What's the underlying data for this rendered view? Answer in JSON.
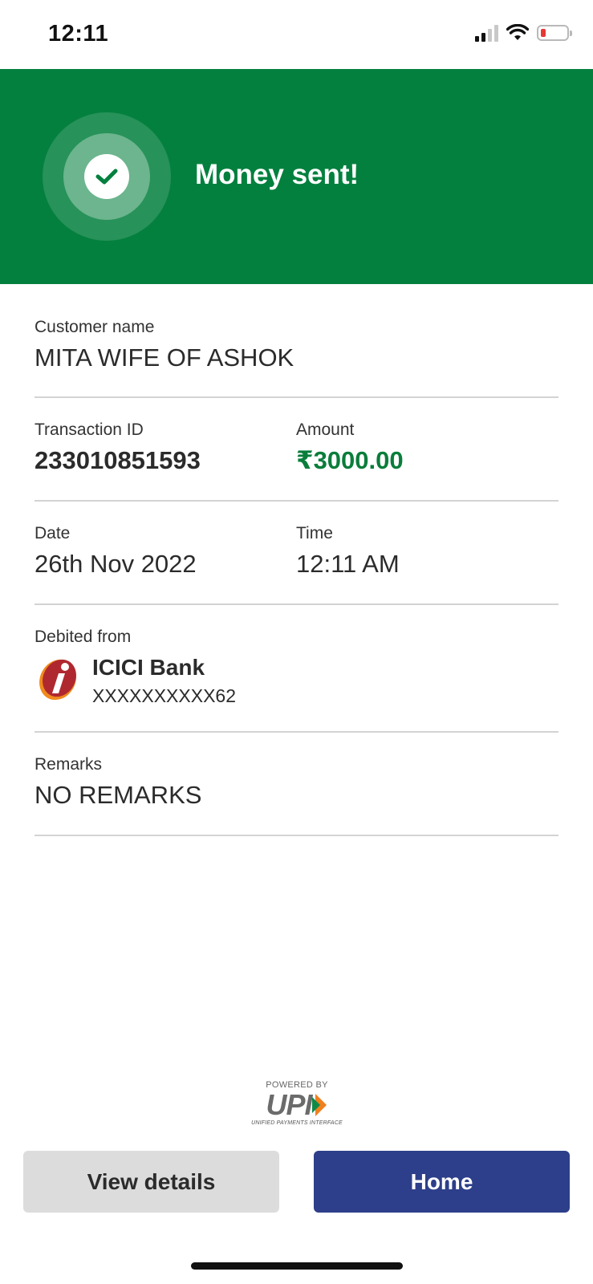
{
  "status_bar": {
    "time": "12:11",
    "icons": [
      "cellular-signal-icon",
      "wifi-icon",
      "battery-low-icon"
    ],
    "battery_color": "#e53935"
  },
  "header": {
    "title": "Money sent!",
    "background_color": "#04803e",
    "icon": "check-circle-icon"
  },
  "customer": {
    "label": "Customer name",
    "value": "MITA WIFE OF ASHOK"
  },
  "transaction": {
    "id_label": "Transaction ID",
    "id_value": "233010851593",
    "amount_label": "Amount",
    "amount_value": "₹3000.00",
    "amount_color": "#0a7d3b"
  },
  "datetime": {
    "date_label": "Date",
    "date_value": "26th Nov 2022",
    "time_label": "Time",
    "time_value": "12:11 AM"
  },
  "debited": {
    "label": "Debited from",
    "bank_name": "ICICI Bank",
    "account": "XXXXXXXXXX62",
    "logo_icon": "icici-bank-logo"
  },
  "remarks": {
    "label": "Remarks",
    "value": "NO REMARKS"
  },
  "branding": {
    "powered_by": "POWERED BY",
    "upi_word": "UPI",
    "upi_subtitle": "UNIFIED PAYMENTS INTERFACE"
  },
  "actions": {
    "view_details": "View details",
    "home": "Home",
    "primary_color": "#2d3f8a"
  }
}
